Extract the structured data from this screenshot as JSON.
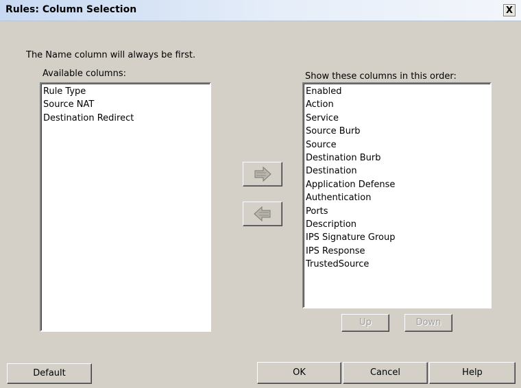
{
  "window": {
    "title": "Rules: Column Selection",
    "close_symbol": "X"
  },
  "note": "The Name column will always be first.",
  "available": {
    "label": "Available columns:",
    "items": [
      "Rule Type",
      "Source NAT",
      "Destination Redirect"
    ]
  },
  "shown": {
    "label": "Show these columns in this order:",
    "items": [
      "Enabled",
      "Action",
      "Service",
      "Source Burb",
      "Source",
      "Destination Burb",
      "Destination",
      "Application Defense",
      "Authentication",
      "Ports",
      "Description",
      "IPS Signature Group",
      "IPS Response",
      "TrustedSource"
    ]
  },
  "move_buttons": {
    "add_icon": "right-arrow-icon",
    "remove_icon": "left-arrow-icon"
  },
  "order_buttons": {
    "up": "Up",
    "down": "Down"
  },
  "footer": {
    "default": "Default",
    "ok": "OK",
    "cancel": "Cancel",
    "help": "Help"
  },
  "colors": {
    "dialog_bg": "#d4d0c8",
    "title_bg": "#c7d9f2",
    "disabled_text": "#a0a0a0"
  }
}
